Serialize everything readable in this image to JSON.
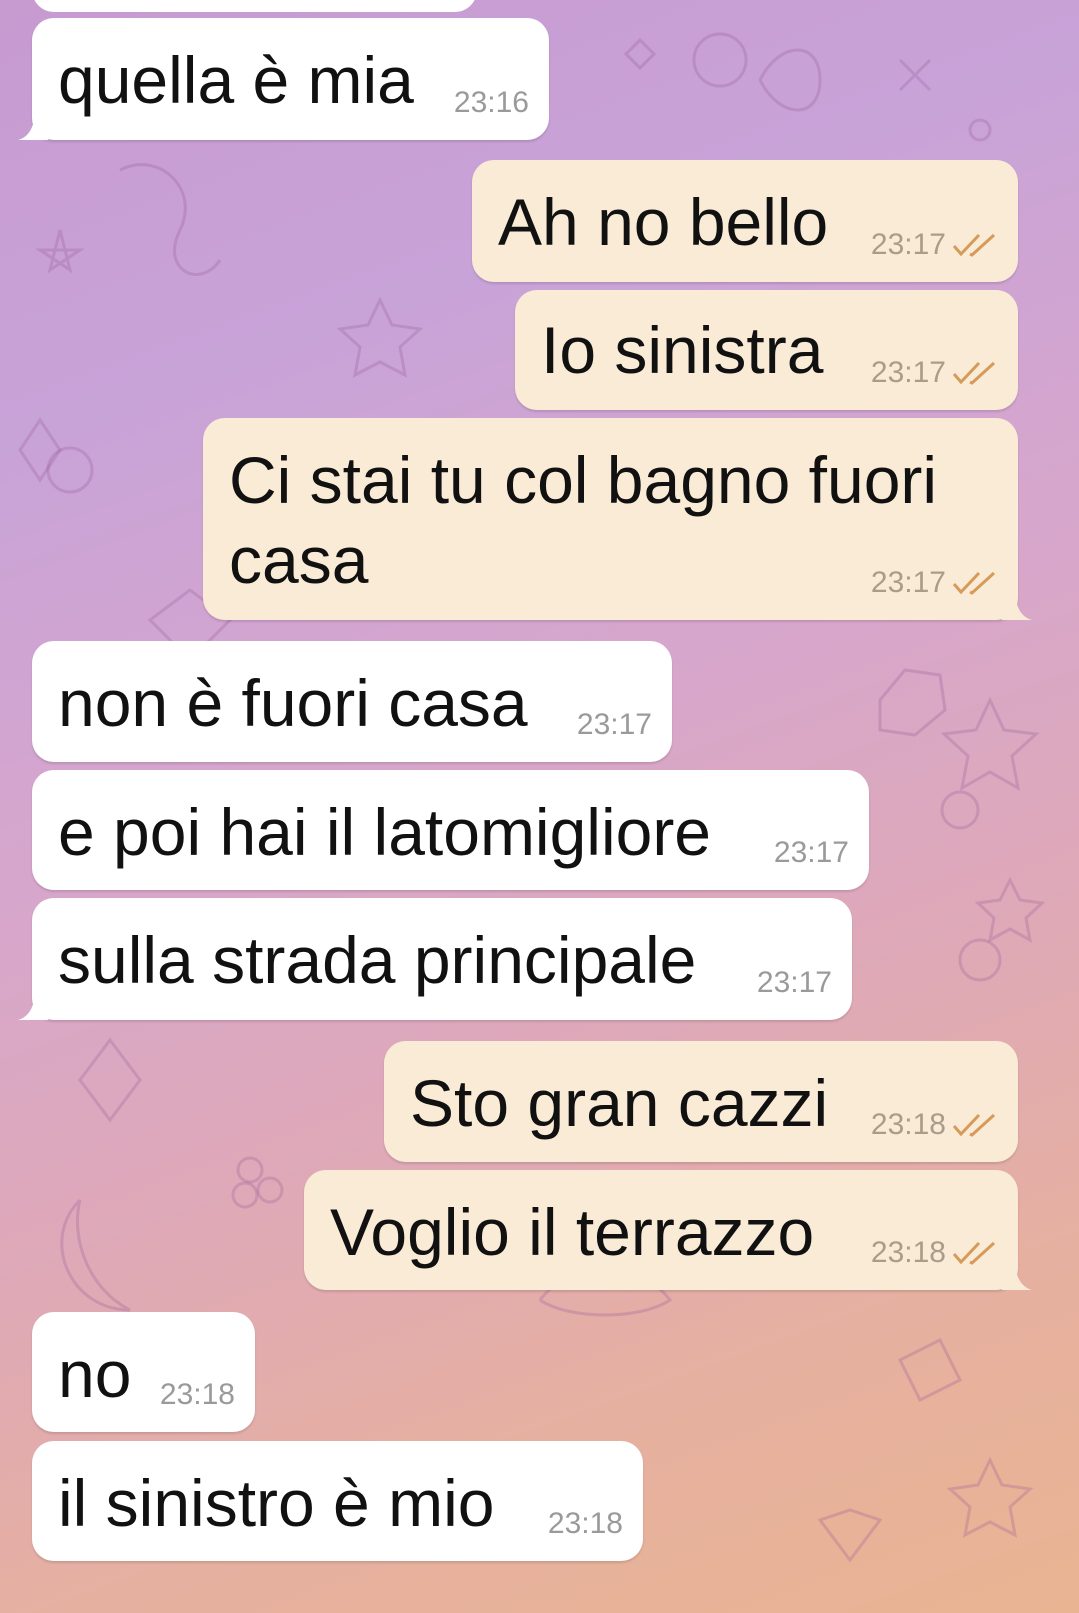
{
  "colors": {
    "incoming_bubble": "#ffffff",
    "outgoing_bubble": "#faebd7",
    "read_check": "#d69a5a"
  },
  "messages": [
    {
      "direction": "in",
      "text": "quella è mia",
      "time": "23:16"
    },
    {
      "direction": "out",
      "text": "Ah no bello",
      "time": "23:17",
      "status_icon": "double-check-icon"
    },
    {
      "direction": "out",
      "text": "Io sinistra",
      "time": "23:17",
      "status_icon": "double-check-icon"
    },
    {
      "direction": "out",
      "text": "Ci stai tu col bagno fuori\ncasa",
      "time": "23:17",
      "status_icon": "double-check-icon"
    },
    {
      "direction": "in",
      "text": "non è fuori casa",
      "time": "23:17"
    },
    {
      "direction": "in",
      "text": "e poi hai il latomigliore",
      "time": "23:17"
    },
    {
      "direction": "in",
      "text": "sulla strada principale",
      "time": "23:17"
    },
    {
      "direction": "out",
      "text": "Sto gran cazzi",
      "time": "23:18",
      "status_icon": "double-check-icon"
    },
    {
      "direction": "out",
      "text": "Voglio il terrazzo",
      "time": "23:18",
      "status_icon": "double-check-icon"
    },
    {
      "direction": "in",
      "text": "no",
      "time": "23:18"
    },
    {
      "direction": "in",
      "text": "il sinistro è mio",
      "time": "23:18"
    }
  ]
}
